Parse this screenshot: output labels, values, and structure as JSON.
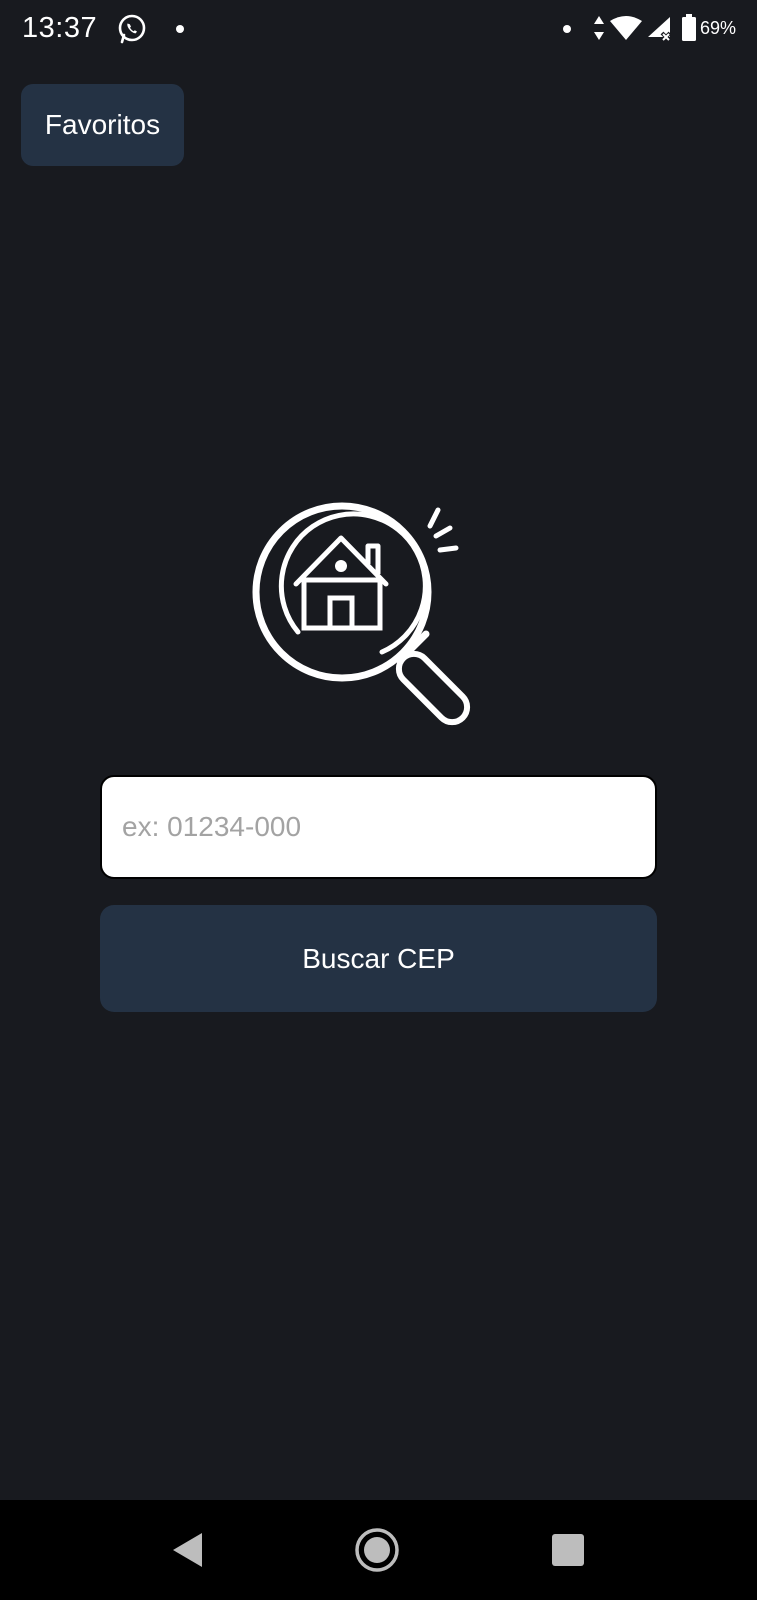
{
  "status_bar": {
    "time": "13:37",
    "battery_percent": "69%",
    "icons": [
      "whatsapp-icon",
      "notification-dot-icon",
      "data-arrows-icon",
      "wifi-icon",
      "signal-icon",
      "battery-icon"
    ]
  },
  "header": {
    "favorites_label": "Favoritos"
  },
  "illustration": {
    "icon": "house-search-icon"
  },
  "search": {
    "value": "",
    "placeholder": "ex: 01234-000",
    "button_label": "Buscar CEP"
  },
  "nav_bar": {
    "icons": [
      "back-icon",
      "home-icon",
      "recents-icon"
    ]
  },
  "colors": {
    "background": "#181a1f",
    "button": "#243244",
    "input_background": "#ffffff",
    "placeholder": "#a3a3a3",
    "text": "#ffffff"
  }
}
